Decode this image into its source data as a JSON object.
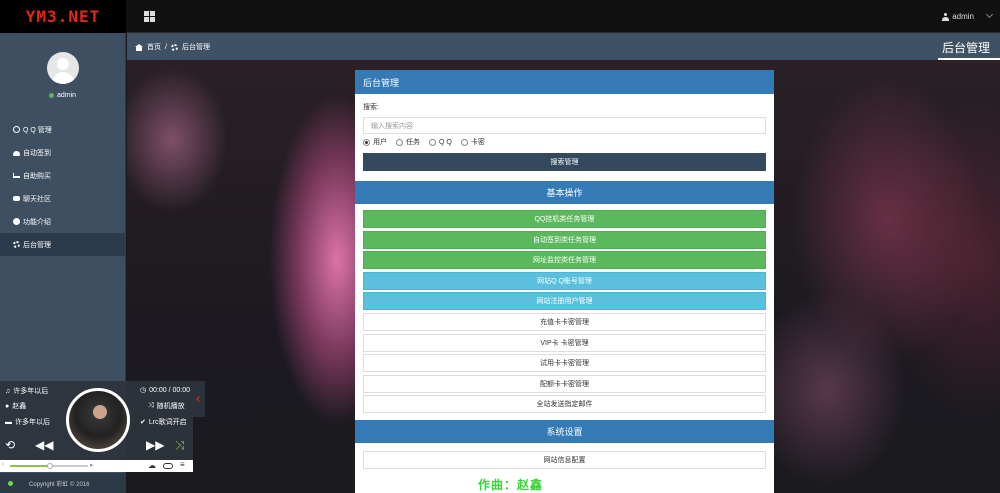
{
  "brand": "YM3.NET",
  "topbar": {
    "user_label": "admin"
  },
  "sidebar": {
    "status": "admin",
    "items": [
      {
        "label": "Q Q 管理",
        "icon": "globe-icon"
      },
      {
        "label": "自动签到",
        "icon": "cloud-icon"
      },
      {
        "label": "自助购买",
        "icon": "cart-icon"
      },
      {
        "label": "聊天社区",
        "icon": "chat-icon"
      },
      {
        "label": "功能介绍",
        "icon": "info-icon"
      },
      {
        "label": "后台管理",
        "icon": "gear-icon"
      }
    ]
  },
  "breadcrumb": {
    "home": "首页",
    "separator": "/",
    "current": "后台管理"
  },
  "page_title": "后台管理",
  "panel": {
    "title": "后台管理",
    "search_label": "搜索:",
    "search_placeholder": "输入搜索内容",
    "radios": [
      {
        "label": "用户",
        "checked": true
      },
      {
        "label": "任务",
        "checked": false
      },
      {
        "label": "Q Q",
        "checked": false
      },
      {
        "label": "卡密",
        "checked": false
      }
    ],
    "search_button": "搜索管理",
    "basic_ops_title": "基本操作",
    "basic_ops": [
      {
        "label": "QQ挂机类任务管理",
        "style": "green"
      },
      {
        "label": "自动签到类任务管理",
        "style": "green"
      },
      {
        "label": "网址监控类任务管理",
        "style": "green"
      },
      {
        "label": "网站Q Q账号管理",
        "style": "blue"
      },
      {
        "label": "网站注册用户管理",
        "style": "blue"
      },
      {
        "label": "充值卡卡密管理",
        "style": "white"
      },
      {
        "label": "VIP卡 卡密管理",
        "style": "white"
      },
      {
        "label": "试用卡卡密管理",
        "style": "white"
      },
      {
        "label": "配额卡卡密管理",
        "style": "white"
      },
      {
        "label": "全站发送指定邮件",
        "style": "white"
      }
    ],
    "system_title": "系统设置",
    "system_ops": [
      {
        "label": "网站信息配置",
        "style": "white"
      }
    ]
  },
  "player": {
    "song": "许多年以后",
    "artist": "赵鑫",
    "album": "许多年以后",
    "time": "00:00 / 00:00",
    "mode": "随机播放",
    "lyric_status": "Lrc歌词开启",
    "volume": 0.5
  },
  "lyric_line": "作曲：赵鑫",
  "footer": {
    "copyright": "Copyright 彩虹 © 2016"
  },
  "colors": {
    "brand": "#e1251b",
    "primary": "#337ab7",
    "success": "#5cb85c",
    "info": "#5bc0de",
    "dark": "#34495e"
  }
}
